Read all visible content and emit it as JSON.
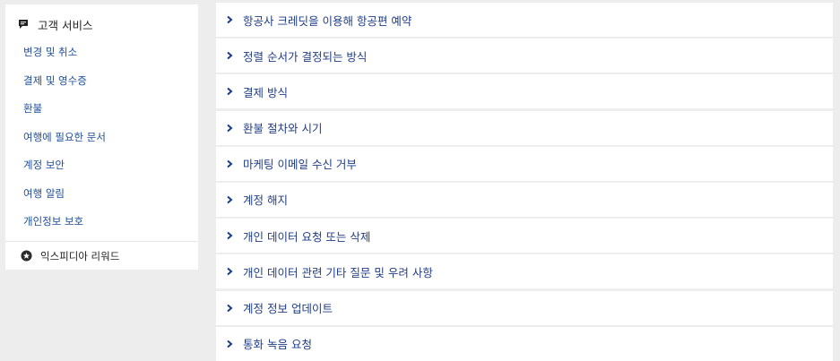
{
  "sidebar": {
    "header": {
      "icon": "chat-bubble-icon",
      "label": "고객 서비스"
    },
    "items": [
      {
        "label": "변경 및 취소"
      },
      {
        "label": "결제 및 영수증"
      },
      {
        "label": "환불"
      },
      {
        "label": "여행에 필요한 문서"
      },
      {
        "label": "계정 보안"
      },
      {
        "label": "여행 알림"
      },
      {
        "label": "개인정보 보호"
      }
    ],
    "footer": {
      "icon": "rewards-icon",
      "label": "익스피디아 리워드"
    }
  },
  "faq": {
    "chevron_icon": "chevron-right-icon",
    "items": [
      {
        "label": "항공사 크레딧을 이용해 항공편 예약"
      },
      {
        "label": "정렬 순서가 결정되는 방식"
      },
      {
        "label": "결제 방식"
      },
      {
        "label": "환불 절차와 시기"
      },
      {
        "label": "마케팅 이메일 수신 거부"
      },
      {
        "label": "계정 해지"
      },
      {
        "label": "개인 데이터 요청 또는 삭제"
      },
      {
        "label": "개인 데이터 관련 기타 질문 및 우려 사항"
      },
      {
        "label": "계정 정보 업데이트"
      },
      {
        "label": "통화 녹음 요청"
      }
    ]
  },
  "colors": {
    "link": "#1f4e9a",
    "faq_text": "#1f3c88",
    "background": "#ededed",
    "panel": "#ffffff"
  }
}
